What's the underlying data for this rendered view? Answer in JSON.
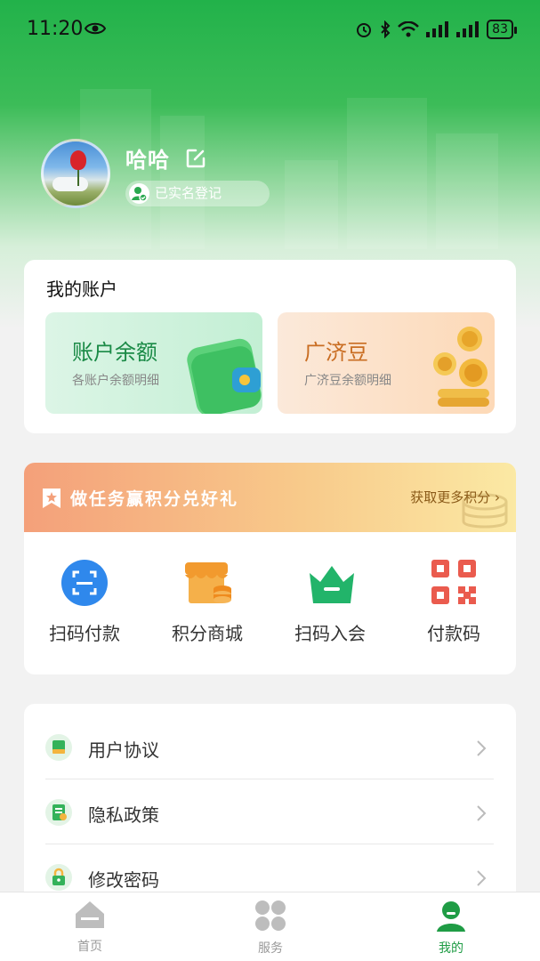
{
  "status_bar": {
    "time": "11:20",
    "battery": "83"
  },
  "profile": {
    "name": "哈哈",
    "verified_label": "已实名登记"
  },
  "account": {
    "title": "我的账户",
    "tiles": [
      {
        "title": "账户余额",
        "subtitle": "各账户余额明细"
      },
      {
        "title": "广济豆",
        "subtitle": "广济豆余额明细"
      }
    ]
  },
  "task_banner": {
    "title": "做任务赢积分兑好礼",
    "more": "获取更多积分"
  },
  "quick_actions": [
    {
      "label": "扫码付款",
      "icon": "scan-icon"
    },
    {
      "label": "积分商城",
      "icon": "store-icon"
    },
    {
      "label": "扫码入会",
      "icon": "crown-icon"
    },
    {
      "label": "付款码",
      "icon": "qr-code-icon"
    }
  ],
  "menu": [
    {
      "label": "用户协议",
      "icon": "agreement-icon"
    },
    {
      "label": "隐私政策",
      "icon": "privacy-icon"
    },
    {
      "label": "修改密码",
      "icon": "lock-icon"
    }
  ],
  "tab_bar": [
    {
      "label": "首页",
      "icon": "home-icon"
    },
    {
      "label": "服务",
      "icon": "services-icon"
    },
    {
      "label": "我的",
      "icon": "profile-icon",
      "active": true
    }
  ],
  "colors": {
    "brand": "#22b24a",
    "active_tab": "#1f9c45"
  }
}
